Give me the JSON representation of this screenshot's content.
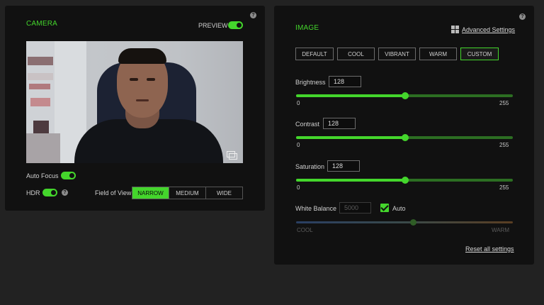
{
  "camera": {
    "title": "CAMERA",
    "preview_label": "PREVIEW",
    "preview_on": true,
    "autofocus_label": "Auto Focus",
    "autofocus_on": true,
    "hdr_label": "HDR",
    "hdr_on": true,
    "fov_label": "Field of View",
    "fov_options": [
      "NARROW",
      "MEDIUM",
      "WIDE"
    ],
    "fov_selected": "NARROW"
  },
  "image": {
    "title": "IMAGE",
    "advanced_label": "Advanced Settings",
    "presets": [
      "DEFAULT",
      "COOL",
      "VIBRANT",
      "WARM",
      "CUSTOM"
    ],
    "preset_selected": "CUSTOM",
    "sliders": [
      {
        "label": "Brightness",
        "value": "128",
        "min": "0",
        "max": "255"
      },
      {
        "label": "Contrast",
        "value": "128",
        "min": "0",
        "max": "255"
      },
      {
        "label": "Saturation",
        "value": "128",
        "min": "0",
        "max": "255"
      }
    ],
    "white_balance": {
      "label": "White Balance",
      "value": "5000",
      "auto_label": "Auto",
      "auto_on": true,
      "level": 0.54,
      "cool_label": "COOL",
      "warm_label": "WARM"
    },
    "reset_label": "Reset all settings"
  },
  "colors": {
    "accent": "#44d62c",
    "panel": "#111111",
    "background": "#222222"
  }
}
